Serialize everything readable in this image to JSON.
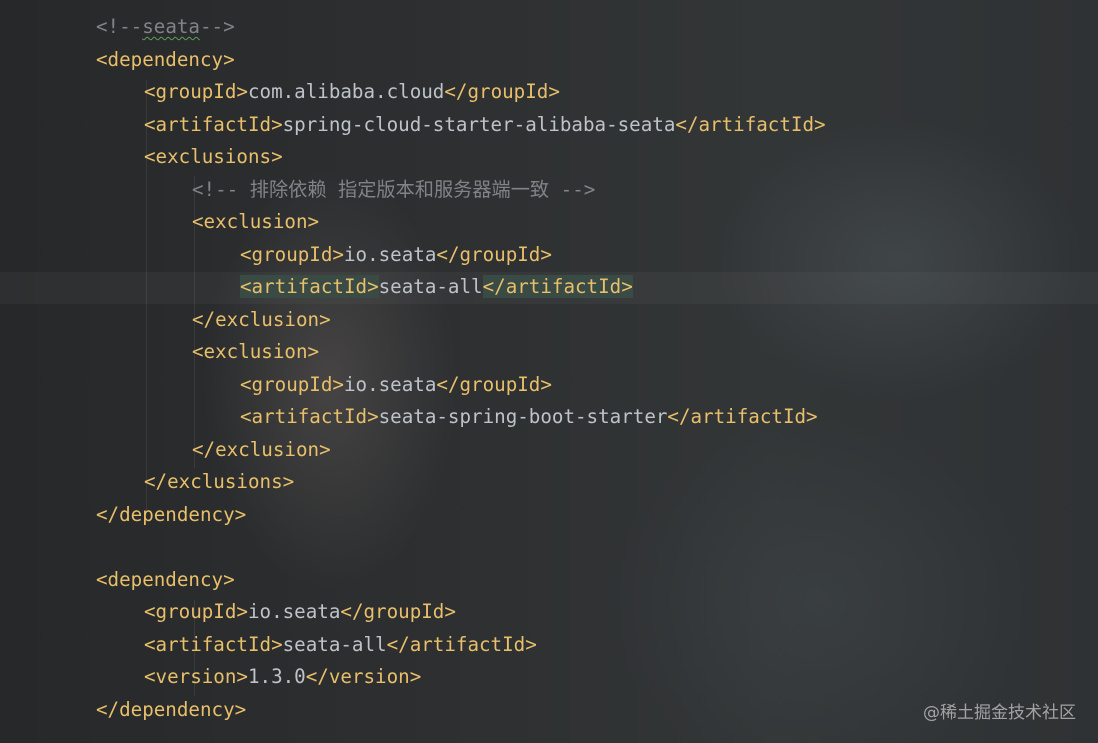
{
  "code_lines": [
    {
      "id": "l1",
      "parts": [
        {
          "c": "cmt",
          "t": "<!--"
        },
        {
          "c": "cmt squig",
          "t": "seata"
        },
        {
          "c": "cmt",
          "t": "-->"
        }
      ]
    },
    {
      "id": "l2",
      "parts": [
        {
          "c": "tag",
          "t": "<dependency>"
        }
      ]
    },
    {
      "id": "l3",
      "parts": [
        {
          "c": "tag",
          "t": "<groupId>"
        },
        {
          "c": "txt",
          "t": "com.alibaba.cloud"
        },
        {
          "c": "tag",
          "t": "</groupId>"
        }
      ]
    },
    {
      "id": "l4",
      "parts": [
        {
          "c": "tag",
          "t": "<artifactId>"
        },
        {
          "c": "txt",
          "t": "spring-cloud-starter-alibaba-seata"
        },
        {
          "c": "tag",
          "t": "</artifactId>"
        }
      ]
    },
    {
      "id": "l5",
      "parts": [
        {
          "c": "tag",
          "t": "<exclusions>"
        }
      ]
    },
    {
      "id": "l6",
      "parts": [
        {
          "c": "cmt",
          "t": "<!-- 排除依赖 指定版本和服务器端一致 -->"
        }
      ]
    },
    {
      "id": "l7",
      "parts": [
        {
          "c": "tag",
          "t": "<exclusion>"
        }
      ]
    },
    {
      "id": "l8",
      "parts": [
        {
          "c": "tag",
          "t": "<groupId>"
        },
        {
          "c": "txt",
          "t": "io.seata"
        },
        {
          "c": "tag",
          "t": "</groupId>"
        }
      ]
    },
    {
      "id": "l9",
      "parts": [
        {
          "c": "tag match",
          "t": "<artifactId>"
        },
        {
          "c": "txt",
          "t": "seata-all"
        },
        {
          "c": "tag match",
          "t": "</artifactId>"
        }
      ]
    },
    {
      "id": "l10",
      "parts": [
        {
          "c": "tag",
          "t": "</exclusion>"
        }
      ]
    },
    {
      "id": "l11",
      "parts": [
        {
          "c": "tag",
          "t": "<exclusion>"
        }
      ]
    },
    {
      "id": "l12",
      "parts": [
        {
          "c": "tag",
          "t": "<groupId>"
        },
        {
          "c": "txt",
          "t": "io.seata"
        },
        {
          "c": "tag",
          "t": "</groupId>"
        }
      ]
    },
    {
      "id": "l13",
      "parts": [
        {
          "c": "tag",
          "t": "<artifactId>"
        },
        {
          "c": "txt",
          "t": "seata-spring-boot-starter"
        },
        {
          "c": "tag",
          "t": "</artifactId>"
        }
      ]
    },
    {
      "id": "l14",
      "parts": [
        {
          "c": "tag",
          "t": "</exclusion>"
        }
      ]
    },
    {
      "id": "l15",
      "parts": [
        {
          "c": "tag",
          "t": "</exclusions>"
        }
      ]
    },
    {
      "id": "l16",
      "parts": [
        {
          "c": "tag",
          "t": "</dependency>"
        }
      ]
    },
    {
      "id": "l17",
      "parts": []
    },
    {
      "id": "l18",
      "parts": [
        {
          "c": "tag",
          "t": "<dependency>"
        }
      ]
    },
    {
      "id": "l19",
      "parts": [
        {
          "c": "tag",
          "t": "<groupId>"
        },
        {
          "c": "txt",
          "t": "io.seata"
        },
        {
          "c": "tag",
          "t": "</groupId>"
        }
      ]
    },
    {
      "id": "l20",
      "parts": [
        {
          "c": "tag",
          "t": "<artifactId>"
        },
        {
          "c": "txt",
          "t": "seata-all"
        },
        {
          "c": "tag",
          "t": "</artifactId>"
        }
      ]
    },
    {
      "id": "l21",
      "parts": [
        {
          "c": "tag",
          "t": "<version>"
        },
        {
          "c": "txt",
          "t": "1.3.0"
        },
        {
          "c": "tag",
          "t": "</version>"
        }
      ]
    },
    {
      "id": "l22",
      "parts": [
        {
          "c": "tag",
          "t": "</dependency>"
        }
      ]
    }
  ],
  "watermark": "@稀土掘金技术社区",
  "colors": {
    "tag": "#e8bf6a",
    "text": "#bdc3c9",
    "comment": "#7f8489",
    "tag_match_highlight": "#3a4a45"
  }
}
